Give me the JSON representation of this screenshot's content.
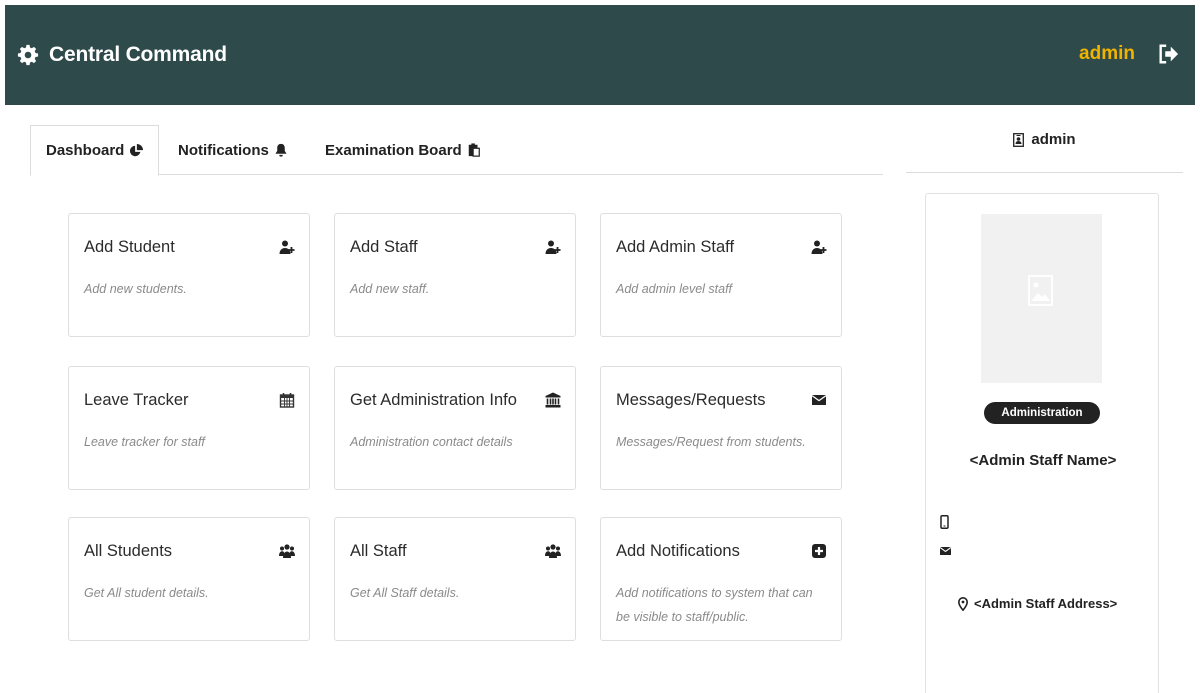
{
  "header": {
    "brand_title": "Central Command",
    "brand_icon": "gear-icon",
    "user_name": "admin",
    "logout_icon": "sign-out-icon",
    "bar_color": "#2e4a4a",
    "user_color": "#f0b400"
  },
  "tabs": [
    {
      "label": "Dashboard",
      "icon": "pie-chart-icon",
      "active": true
    },
    {
      "label": "Notifications",
      "icon": "bell-icon",
      "active": false
    },
    {
      "label": "Examination Board",
      "icon": "clipboard-icon",
      "active": false
    }
  ],
  "cards": [
    {
      "title": "Add Student",
      "desc": "Add new students.",
      "icon": "user-plus-icon"
    },
    {
      "title": "Add Staff",
      "desc": "Add new staff.",
      "icon": "user-plus-icon"
    },
    {
      "title": "Add Admin Staff",
      "desc": "Add admin level staff",
      "icon": "user-plus-icon"
    },
    {
      "title": "Leave Tracker",
      "desc": "Leave tracker for staff",
      "icon": "calendar-icon"
    },
    {
      "title": "Get Administration Info",
      "desc": "Administration contact details",
      "icon": "bank-icon"
    },
    {
      "title": "Messages/Requests",
      "desc": "Messages/Request from students.",
      "icon": "envelope-icon"
    },
    {
      "title": "All Students",
      "desc": "Get All student details.",
      "icon": "users-icon"
    },
    {
      "title": "All Staff",
      "desc": "Get All Staff details.",
      "icon": "users-icon"
    },
    {
      "title": "Add Notifications",
      "desc": "Add notifications to system that can be visible to staff/public.",
      "icon": "plus-square-icon"
    }
  ],
  "profile": {
    "header_label": "admin",
    "header_icon": "id-badge-icon",
    "photo_icon": "image-placeholder-icon",
    "badge": "Administration",
    "name": "<Admin Staff Name>",
    "phone": "",
    "email": "",
    "address": "<Admin Staff Address>"
  }
}
